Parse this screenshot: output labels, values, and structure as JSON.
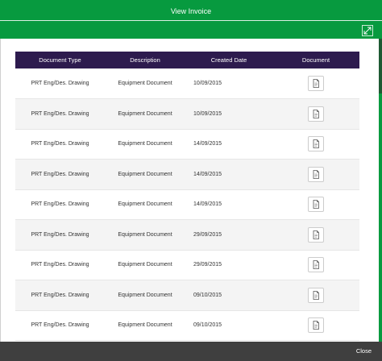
{
  "modal": {
    "title": "View Invoice",
    "close_label": "Close",
    "accent_color": "#079a3f",
    "header_color": "#2d1b4e"
  },
  "table": {
    "columns": [
      "Document Type",
      "Description",
      "Created Date",
      "Document"
    ],
    "rows": [
      {
        "type": "PRT Eng/Des. Drawing",
        "description": "Equipment Document",
        "date": "10/09/2015",
        "icon": "document-icon"
      },
      {
        "type": "PRT Eng/Des. Drawing",
        "description": "Equipment Document",
        "date": "10/09/2015",
        "icon": "document-icon"
      },
      {
        "type": "PRT Eng/Des. Drawing",
        "description": "Equipment Document",
        "date": "14/09/2015",
        "icon": "document-icon"
      },
      {
        "type": "PRT Eng/Des. Drawing",
        "description": "Equipment Document",
        "date": "14/09/2015",
        "icon": "document-icon"
      },
      {
        "type": "PRT Eng/Des. Drawing",
        "description": "Equipment Document",
        "date": "14/09/2015",
        "icon": "document-icon"
      },
      {
        "type": "PRT Eng/Des. Drawing",
        "description": "Equipment Document",
        "date": "29/09/2015",
        "icon": "document-icon"
      },
      {
        "type": "PRT Eng/Des. Drawing",
        "description": "Equipment Document",
        "date": "29/09/2015",
        "icon": "document-icon"
      },
      {
        "type": "PRT Eng/Des. Drawing",
        "description": "Equipment Document",
        "date": "09/10/2015",
        "icon": "document-icon"
      },
      {
        "type": "PRT Eng/Des. Drawing",
        "description": "Equipment Document",
        "date": "09/10/2015",
        "icon": "document-icon"
      }
    ]
  }
}
